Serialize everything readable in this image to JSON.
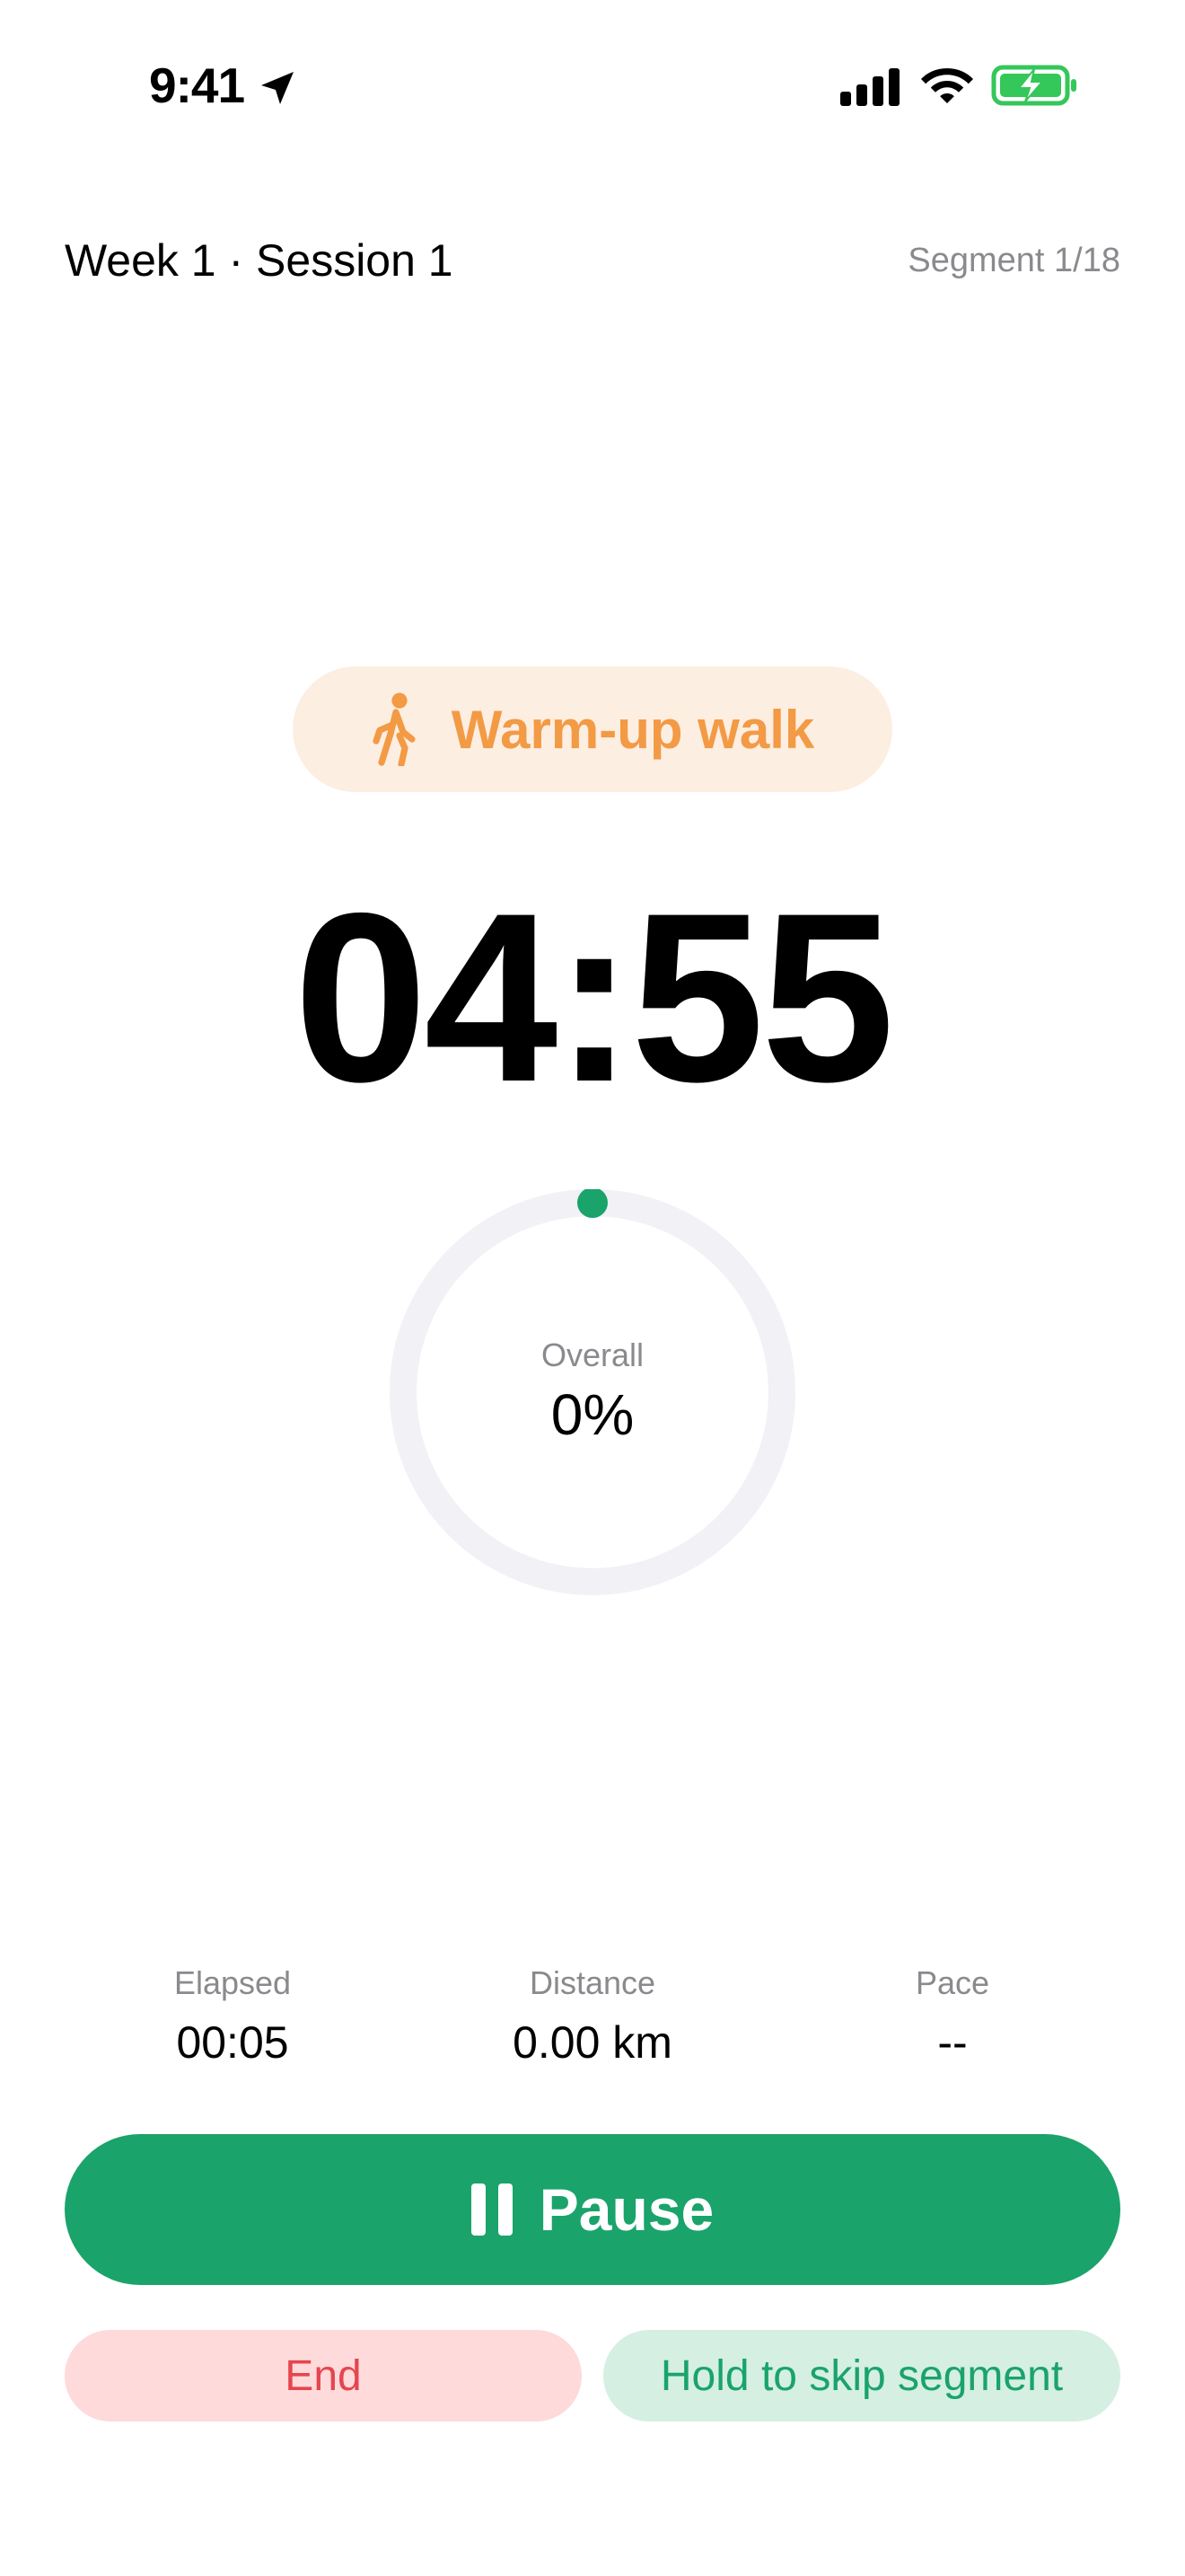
{
  "status_bar": {
    "time": "9:41",
    "icons": [
      "location-arrow-icon",
      "cellular-signal-icon",
      "wifi-icon",
      "battery-charging-icon"
    ]
  },
  "header": {
    "session_title": "Week 1 · Session 1",
    "segment_counter": "Segment 1/18"
  },
  "phase": {
    "icon": "walking-figure-icon",
    "label": "Warm-up walk",
    "color": "#f39a45",
    "background": "#fdeee2"
  },
  "timer": {
    "countdown": "04:55"
  },
  "progress": {
    "caption": "Overall",
    "value_text": "0%",
    "fraction": 0.0,
    "accent": "#1aa36b"
  },
  "stats": [
    {
      "label": "Elapsed",
      "value": "00:05"
    },
    {
      "label": "Distance",
      "value": "0.00 km"
    },
    {
      "label": "Pace",
      "value": "--"
    }
  ],
  "controls": {
    "pause_label": "Pause",
    "pause_icon": "pause-icon",
    "end_label": "End",
    "skip_label": "Hold to skip segment"
  }
}
